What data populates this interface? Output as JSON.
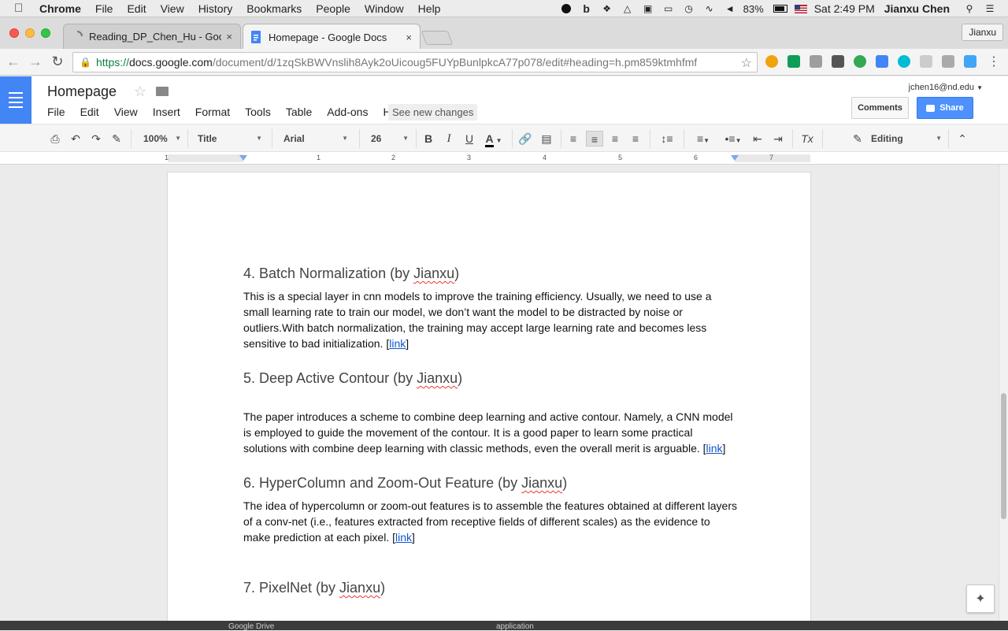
{
  "macbar": {
    "menus": [
      "Chrome",
      "File",
      "Edit",
      "View",
      "History",
      "Bookmarks",
      "People",
      "Window",
      "Help"
    ],
    "battery": "83%",
    "clock": "Sat 2:49 PM",
    "user": "Jianxu Chen"
  },
  "tabs": [
    {
      "title": "Reading_DP_Chen_Hu - Goog",
      "close": "×"
    },
    {
      "title": "Homepage - Google Docs",
      "close": "×"
    }
  ],
  "profile_button": "Jianxu",
  "address": {
    "scheme": "https://",
    "host": "docs.google.com",
    "path": "/document/d/1zqSkBWVnslih8Ayk2oUicoug5FUYpBunlpkcA77p078/edit#heading=h.pm859ktmhfmf"
  },
  "docs": {
    "title": "Homepage",
    "menu": [
      "File",
      "Edit",
      "View",
      "Insert",
      "Format",
      "Tools",
      "Table",
      "Add-ons",
      "Help"
    ],
    "see_changes": "See new changes",
    "account": "jchen16@nd.edu",
    "comments": "Comments",
    "share": "Share"
  },
  "format_toolbar": {
    "zoom": "100%",
    "style": "Title",
    "font": "Arial",
    "size": "26",
    "bold": "B",
    "italic": "I",
    "underline": "U",
    "text_color": "A",
    "clear_format": "Tx",
    "mode": "Editing"
  },
  "ruler": {
    "numbers": [
      "1",
      "1",
      "2",
      "3",
      "4",
      "5",
      "6",
      "7"
    ]
  },
  "document": {
    "sections": [
      {
        "heading_pre": "4. Batch Normalization (by ",
        "heading_name": "Jianxu",
        "heading_post": ")",
        "body": "This is a special layer in cnn models to improve the training efficiency. Usually, we need to use a small learning rate to train our model, we don’t want the model to be distracted by noise or outliers.With batch normalization, the training may accept large learning rate and becomes less sensitive to bad initialization. ",
        "link": "link"
      },
      {
        "heading_pre": "5. Deep Active Contour (by ",
        "heading_name": "Jianxu",
        "heading_post": ")",
        "body": "The paper introduces a scheme to combine deep learning and active contour. Namely, a CNN model is employed to guide the movement of the contour. It is a good paper to learn some practical solutions with combine deep learning with classic methods, even the overall merit is arguable. ",
        "link": "link"
      },
      {
        "heading_pre": "6. HyperColumn and Zoom-Out Feature (by ",
        "heading_name": "Jianxu",
        "heading_post": ")",
        "body": "The idea of hypercolumn or zoom-out features is to assemble the features obtained at different layers of a conv-net (i.e., features extracted from receptive fields of different scales) as the evidence to make prediction at each pixel. ",
        "link": "link"
      },
      {
        "heading_pre": "7. PixelNet (by ",
        "heading_name": "Jianxu",
        "heading_post": ")"
      }
    ]
  },
  "dock": {
    "item1": "Google Drive",
    "item2": "application"
  },
  "colors": {
    "docs_blue": "#4285f4",
    "share_blue": "#4d90fe",
    "link_blue": "#1155cc"
  }
}
